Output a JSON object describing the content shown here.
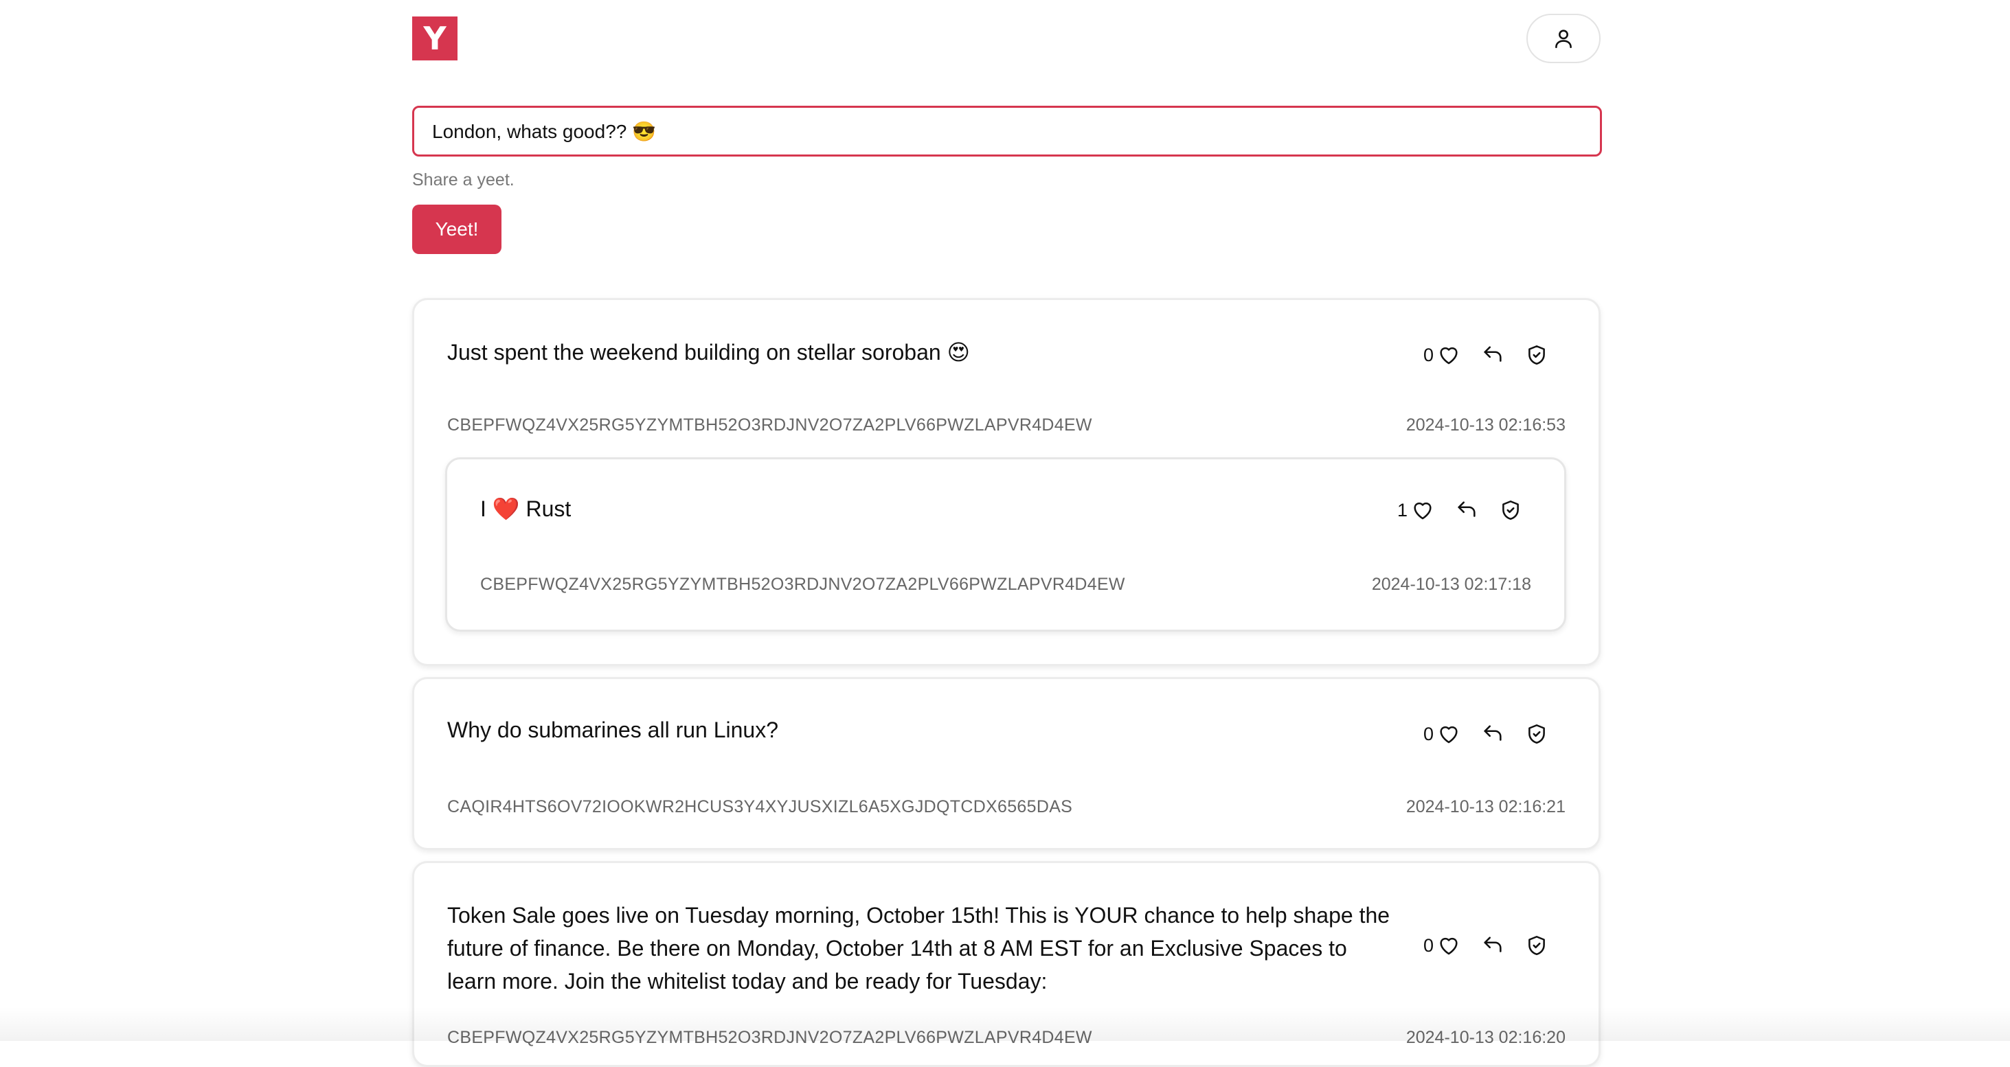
{
  "header": {
    "logo_text": "Y"
  },
  "compose": {
    "value": "London, whats good?? 😎",
    "helper": "Share a yeet.",
    "submit_label": "Yeet!"
  },
  "icons": {
    "profile": "user-icon",
    "like": "heart-icon",
    "reply": "reply-icon",
    "verify": "shield-check-icon"
  },
  "colors": {
    "accent": "#d6364f"
  },
  "posts": [
    {
      "text": "Just spent the weekend building on stellar soroban 😍",
      "likes": "0",
      "author": "CBEPFWQZ4VX25RG5YZYMTBH52O3RDJNV2O7ZA2PLV66PWZLAPVR4D4EW",
      "timestamp": "2024-10-13 02:16:53",
      "replies": [
        {
          "text": "I ❤️ Rust",
          "likes": "1",
          "author": "CBEPFWQZ4VX25RG5YZYMTBH52O3RDJNV2O7ZA2PLV66PWZLAPVR4D4EW",
          "timestamp": "2024-10-13 02:17:18"
        }
      ]
    },
    {
      "text": "Why do submarines all run Linux?",
      "likes": "0",
      "author": "CAQIR4HTS6OV72IOOKWR2HCUS3Y4XYJUSXIZL6A5XGJDQTCDX6565DAS",
      "timestamp": "2024-10-13 02:16:21"
    },
    {
      "text": "Token Sale goes live on Tuesday morning, October 15th! This is YOUR chance to help shape the future of finance. Be there on Monday, October 14th at 8 AM EST for an Exclusive Spaces to learn more. Join the whitelist today and be ready for Tuesday:",
      "likes": "0",
      "author": "CBEPFWQZ4VX25RG5YZYMTBH52O3RDJNV2O7ZA2PLV66PWZLAPVR4D4EW",
      "timestamp": "2024-10-13 02:16:20"
    }
  ]
}
